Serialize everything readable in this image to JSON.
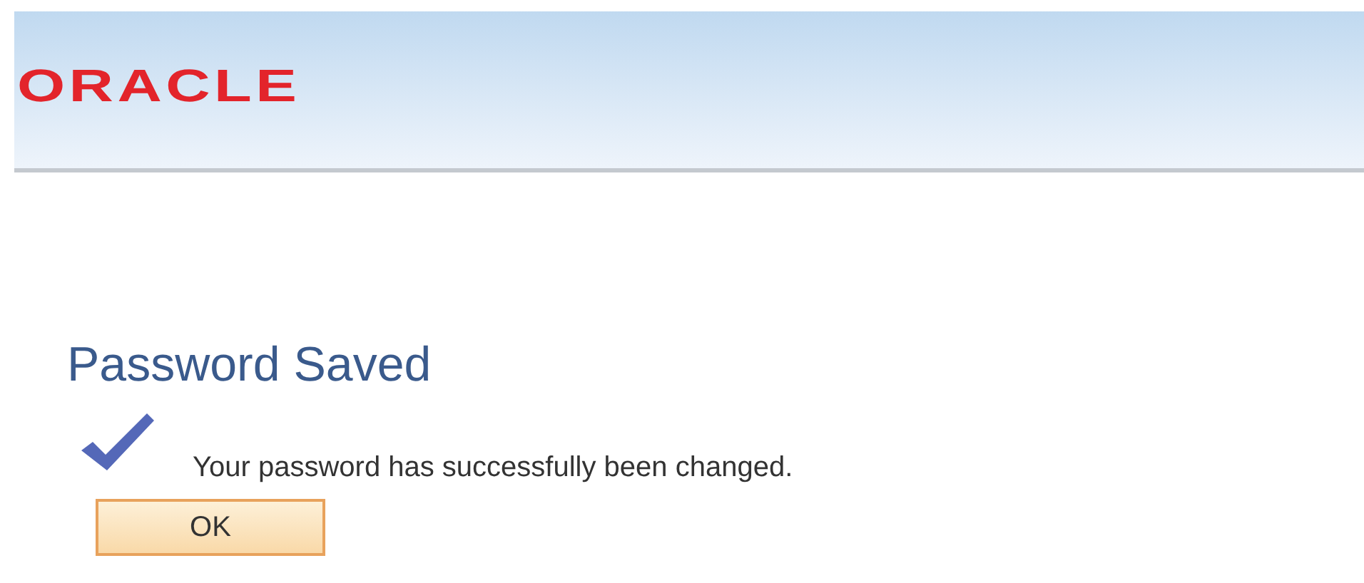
{
  "header": {
    "logo": "ORACLE"
  },
  "page": {
    "title": "Password Saved",
    "message": "Your password has successfully been changed.",
    "buttons": [
      "OK"
    ]
  }
}
